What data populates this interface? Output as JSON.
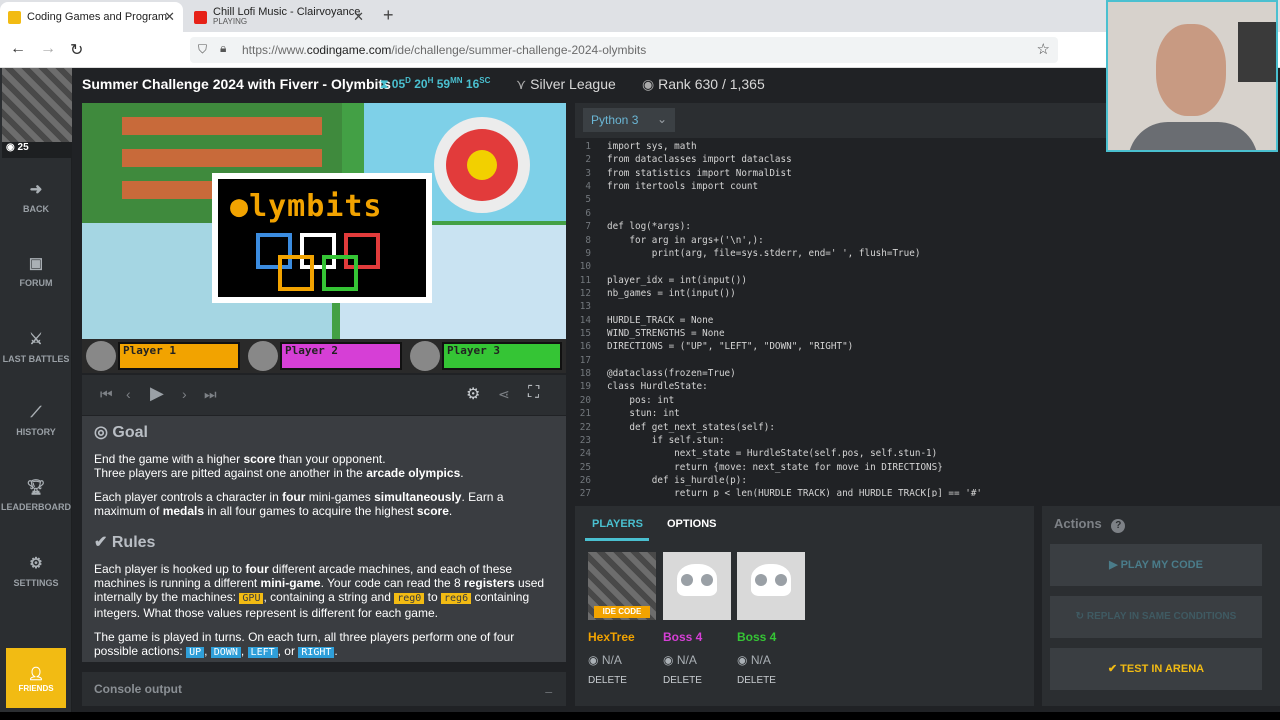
{
  "browser": {
    "tabs": [
      {
        "title": "Coding Games and Programmi"
      },
      {
        "title": "Chill Lofi Music - Clairvoyance",
        "subtitle": "PLAYING"
      }
    ],
    "url_prefix": "https://www.",
    "url_host": "codingame.com",
    "url_path": "/ide/challenge/summer-challenge-2024-olymbits"
  },
  "sidebar": {
    "avatar_level": "25",
    "items": [
      {
        "label": "BACK",
        "icon": "back-arrow-icon"
      },
      {
        "label": "FORUM",
        "icon": "forum-icon"
      },
      {
        "label": "LAST BATTLES",
        "icon": "battles-icon"
      },
      {
        "label": "HISTORY",
        "icon": "history-icon"
      },
      {
        "label": "LEADERBOARD",
        "icon": "trophy-icon"
      },
      {
        "label": "SETTINGS",
        "icon": "gear-icon"
      }
    ],
    "friends_label": "FRIENDS"
  },
  "header": {
    "title": "Summer Challenge 2024 with Fiverr - Olymbits",
    "timer": {
      "d": "05",
      "h": "20",
      "m": "59",
      "s": "16"
    },
    "league": "Silver League",
    "rank_label": "Rank",
    "rank_value": "630",
    "rank_total": "/ 1,365"
  },
  "game": {
    "logo": "lymbits",
    "players": [
      {
        "name": "Player 1",
        "color": "#f2a300"
      },
      {
        "name": "Player 2",
        "color": "#d63fd6"
      },
      {
        "name": "Player 3",
        "color": "#35c535"
      }
    ]
  },
  "statement": {
    "goal_heading": "Goal",
    "goal_p1a": "End the game with a higher ",
    "goal_p1b": "score",
    "goal_p1c": " than your opponent.",
    "goal_p2a": "Three players are pitted against one another in the ",
    "goal_p2b": "arcade olympics",
    "goal_p2c": ".",
    "goal_p3a": "Each player controls a character in ",
    "goal_p3b": "four",
    "goal_p3c": " mini-games ",
    "goal_p3d": "simultaneously",
    "goal_p3e": ". Earn a maximum of ",
    "goal_p3f": "medals",
    "goal_p3g": " in all four games to acquire the highest ",
    "goal_p3h": "score",
    "goal_p3i": ".",
    "rules_heading": "Rules",
    "rules_p1a": "Each player is hooked up to ",
    "rules_p1b": "four",
    "rules_p1c": " different arcade machines, and each of these machines is running a different ",
    "rules_p1d": "mini-game",
    "rules_p1e": ". Your code can read the 8 ",
    "rules_p1f": "registers",
    "rules_p1g": " used internally by the machines: ",
    "rules_tag_gpu": "GPU",
    "rules_p1h": ", containing a string and ",
    "rules_tag_reg0": "reg0",
    "rules_p1i": " to ",
    "rules_tag_reg6": "reg6",
    "rules_p1j": " containing integers. What those values represent is different for each game.",
    "rules_p2a": "The game is played in turns. On each turn, all three players perform one of four possible actions: ",
    "rules_tag_up": "UP",
    "rules_tag_down": "DOWN",
    "rules_tag_left": "LEFT",
    "rules_or": ", or ",
    "rules_tag_right": "RIGHT",
    "rules_end": "."
  },
  "console": {
    "label": "Console output"
  },
  "editor": {
    "language": "Python 3",
    "lines": [
      "import sys, math",
      "from dataclasses import dataclass",
      "from statistics import NormalDist",
      "from itertools import count",
      "",
      "",
      "def log(*args):",
      "    for arg in args+('\\n',):",
      "        print(arg, file=sys.stderr, end=' ', flush=True)",
      "",
      "player_idx = int(input())",
      "nb_games = int(input())",
      "",
      "HURDLE_TRACK = None",
      "WIND_STRENGTHS = None",
      "DIRECTIONS = (\"UP\", \"LEFT\", \"DOWN\", \"RIGHT\")",
      "",
      "@dataclass(frozen=True)",
      "class HurdleState:",
      "    pos: int",
      "    stun: int",
      "    def get_next_states(self):",
      "        if self.stun:",
      "            next_state = HurdleState(self.pos, self.stun-1)",
      "            return {move: next_state for move in DIRECTIONS}",
      "        def is_hurdle(p):",
      "            return p < len(HURDLE_TRACK) and HURDLE_TRACK[p] == '#'"
    ]
  },
  "players_panel": {
    "tabs": [
      "PLAYERS",
      "OPTIONS"
    ],
    "players": [
      {
        "name": "HexTree",
        "color": "#f2a300",
        "badge": "IDE CODE",
        "score": "N/A",
        "delete": "DELETE"
      },
      {
        "name": "Boss 4",
        "color": "#d63fd6",
        "score": "N/A",
        "delete": "DELETE"
      },
      {
        "name": "Boss 4",
        "color": "#35c535",
        "score": "N/A",
        "delete": "DELETE"
      }
    ]
  },
  "actions": {
    "title": "Actions",
    "buttons": [
      "PLAY MY CODE",
      "REPLAY IN SAME CONDITIONS",
      "TEST IN ARENA"
    ]
  }
}
